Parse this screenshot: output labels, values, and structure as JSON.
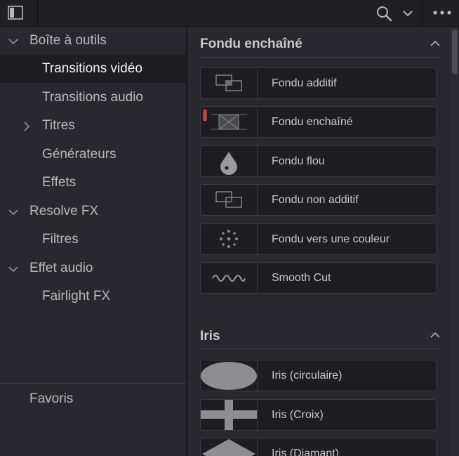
{
  "sidebar": {
    "items": [
      {
        "label": "Boîte à outils",
        "level": 0,
        "expanded": true
      },
      {
        "label": "Transitions vidéo",
        "level": 1,
        "selected": true
      },
      {
        "label": "Transitions audio",
        "level": 1
      },
      {
        "label": "Titres",
        "level": 1,
        "collapsed": true
      },
      {
        "label": "Générateurs",
        "level": 1
      },
      {
        "label": "Effets",
        "level": 1
      },
      {
        "label": "Resolve FX",
        "level": 0,
        "expanded": true
      },
      {
        "label": "Filtres",
        "level": 1
      },
      {
        "label": "Effet audio",
        "level": 0,
        "expanded": true
      },
      {
        "label": "Fairlight FX",
        "level": 1
      }
    ],
    "favorites_label": "Favoris"
  },
  "sections": [
    {
      "title": "Fondu enchaîné",
      "items": [
        {
          "label": "Fondu additif",
          "icon": "overlap-squares-icon"
        },
        {
          "label": "Fondu enchaîné",
          "icon": "cross-dissolve-icon",
          "default_marker": true
        },
        {
          "label": "Fondu flou",
          "icon": "blur-drop-icon"
        },
        {
          "label": "Fondu non additif",
          "icon": "overlap-squares-icon"
        },
        {
          "label": "Fondu vers une couleur",
          "icon": "dotted-circle-icon"
        },
        {
          "label": "Smooth Cut",
          "icon": "wave-icon"
        }
      ]
    },
    {
      "title": "Iris",
      "items": [
        {
          "label": "Iris (circulaire)",
          "icon": "iris-circle-icon"
        },
        {
          "label": "Iris (Croix)",
          "icon": "iris-cross-icon"
        },
        {
          "label": "Iris (Diamant)",
          "icon": "iris-diamond-icon"
        }
      ]
    }
  ],
  "colors": {
    "background": "#28282e",
    "item_background": "#1d1d22",
    "default_marker": "#e0342a"
  }
}
